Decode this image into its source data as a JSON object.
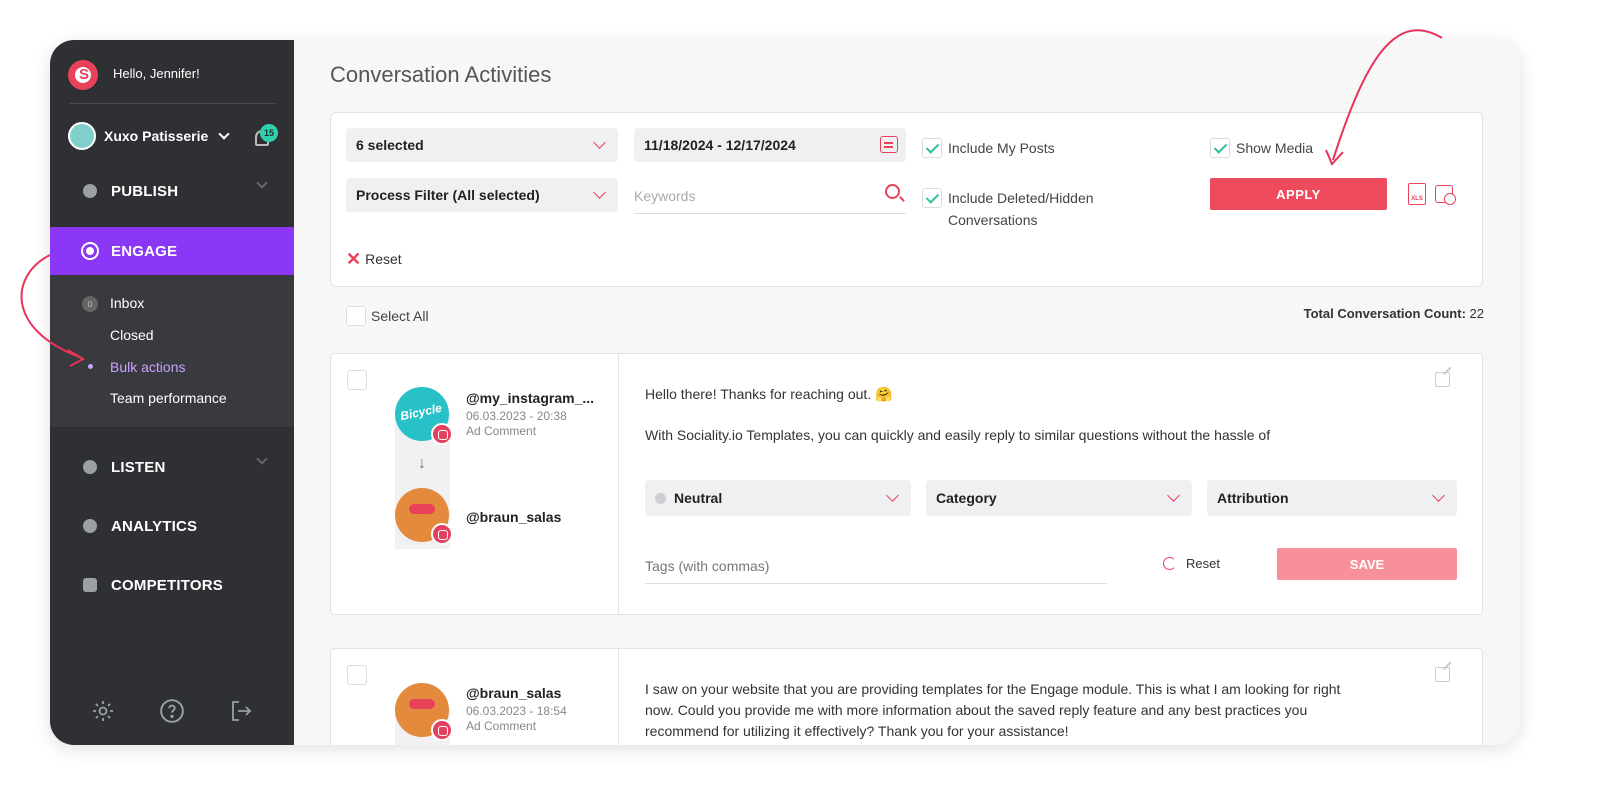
{
  "sidebar": {
    "greeting": "Hello, Jennifer!",
    "brand": "Xuxo Patisserie",
    "notifications": "15",
    "nav": [
      {
        "label": "PUBLISH",
        "icon": "megaphone-icon"
      },
      {
        "label": "ENGAGE",
        "icon": "engage-icon"
      },
      {
        "label": "LISTEN",
        "icon": "listen-icon"
      },
      {
        "label": "ANALYTICS",
        "icon": "analytics-icon"
      },
      {
        "label": "COMPETITORS",
        "icon": "competitors-icon"
      }
    ],
    "sub_items": [
      {
        "label": "Inbox",
        "badge": "0"
      },
      {
        "label": "Closed"
      },
      {
        "label": "Bulk actions"
      },
      {
        "label": "Team performance"
      }
    ],
    "footer_icons": [
      "gear-icon",
      "help-icon",
      "logout-icon"
    ]
  },
  "page": {
    "title": "Conversation Activities"
  },
  "filters": {
    "account_select": "6 selected",
    "date_range": "11/18/2024 - 12/17/2024",
    "process_filter": "Process Filter (All selected)",
    "keywords_placeholder": "Keywords",
    "include_my_posts": "Include My Posts",
    "include_deleted": "Include Deleted/Hidden",
    "include_deleted_2": "Conversations",
    "show_media": "Show Media",
    "apply": "APPLY",
    "xls_label": "XLS",
    "reset": "Reset"
  },
  "list": {
    "select_all": "Select All",
    "total_label": "Total Conversation Count:",
    "total_value": "22"
  },
  "conversations": [
    {
      "handle": "@my_instagram_...",
      "date": "06.03.2023 - 20:38",
      "type": "Ad Comment",
      "reply_handle": "@braun_salas",
      "text_1": "Hello there! Thanks for reaching out. 🤗",
      "text_2": "With Sociality.io Templates, you can quickly and easily reply to similar questions without the hassle of",
      "sentiment": "Neutral",
      "category": "Category",
      "attribution": "Attribution",
      "tags_placeholder": "Tags (with commas)",
      "reset": "Reset",
      "save": "SAVE"
    },
    {
      "handle": "@braun_salas",
      "date": "06.03.2023 - 18:54",
      "type": "Ad Comment",
      "text_1": "I saw on your website that you are providing templates for the Engage module. This is what I am looking for right",
      "text_2": "now. Could you provide me with more information about the saved reply feature and any best practices you",
      "text_3": "recommend for utilizing it effectively? Thank you for your assistance!"
    }
  ],
  "colors": {
    "accent": "#ee4b5e",
    "engage": "#8a38f5",
    "sidebar": "#2e3033",
    "check": "#2fbfa0"
  }
}
